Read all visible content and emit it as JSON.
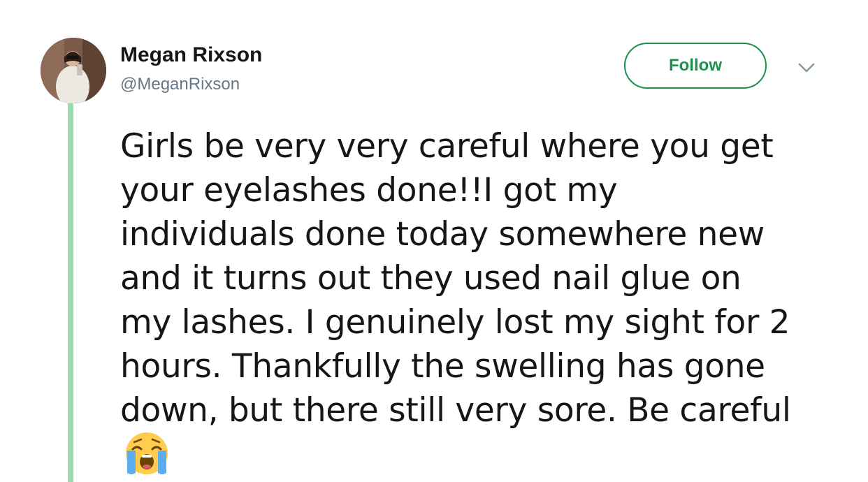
{
  "tweet": {
    "display_name": "Megan Rixson",
    "handle": "@MeganRixson",
    "follow_label": "Follow",
    "text_lines": [
      "Girls be very very careful where you get",
      "your eyelashes done!!I got my",
      "individuals done today somewhere new",
      "and it turns out they used nail glue on",
      "my lashes. I genuinely lost my sight for 2",
      "hours. Thankfully the swelling has gone",
      "down, but there still very sore. Be careful"
    ],
    "emoji": "loudly-crying-face"
  },
  "colors": {
    "follow_accent": "#1f8f4e",
    "thread_line": "#9fd8b4",
    "handle_gray": "#657786",
    "text": "#14171a"
  },
  "icons": {
    "more": "chevron-down-icon",
    "emoji": "loudly-crying-face-icon"
  }
}
